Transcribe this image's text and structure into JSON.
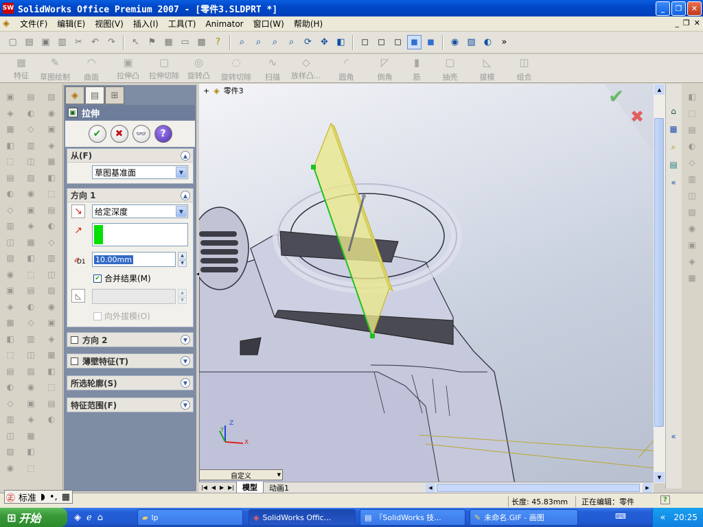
{
  "window": {
    "title": "SolidWorks Office Premium 2007 - [零件3.SLDPRT *]",
    "logo": "SW"
  },
  "menu": {
    "items": [
      "文件(F)",
      "编辑(E)",
      "视图(V)",
      "插入(I)",
      "工具(T)",
      "Animator",
      "窗口(W)",
      "帮助(H)"
    ]
  },
  "commandmanager": {
    "items": [
      "特征",
      "草图绘制",
      "曲面",
      "拉伸凸",
      "拉伸切除",
      "旋转凸",
      "旋转切除",
      "扫描",
      "放样凸...",
      "圆角",
      "倒角",
      "筋",
      "抽壳",
      "拔模",
      "组合"
    ]
  },
  "viewport": {
    "tree_label": "零件3",
    "triad": {
      "x": "X",
      "y": "Y",
      "z": "Z"
    }
  },
  "panel": {
    "feature_title": "拉伸",
    "from": {
      "header": "从(F)",
      "value": "草图基准面"
    },
    "dir1": {
      "header": "方向 1",
      "end_condition": "给定深度",
      "depth_label": "D1",
      "depth_value": "10.00mm",
      "merge_label": "合并结果(M)",
      "merge_checked": true,
      "draft_outward_label": "向外拔模(O)"
    },
    "dir2": {
      "header": "方向 2"
    },
    "thin": {
      "header": "薄壁特征(T)"
    },
    "contours": {
      "header": "所选轮廓(S)"
    },
    "scope": {
      "header": "特征范围(F)"
    }
  },
  "bottom": {
    "config": "自定义",
    "tabs": [
      "模型",
      "动画1"
    ]
  },
  "status": {
    "length": "长度: 45.83mm",
    "editing": "正在编辑：零件"
  },
  "ime": {
    "label": "标准"
  },
  "taskbar": {
    "start": "开始",
    "tasks": [
      "lp",
      "SolidWorks Offic...",
      "『SolidWorks 技...",
      "未命名.GIF - 画图"
    ],
    "time": "20:25"
  },
  "colors": {
    "accent": "#0a5ee0",
    "preview_fill": "#ece884",
    "model_body": "#c4c6da",
    "edge": "#20a020"
  }
}
